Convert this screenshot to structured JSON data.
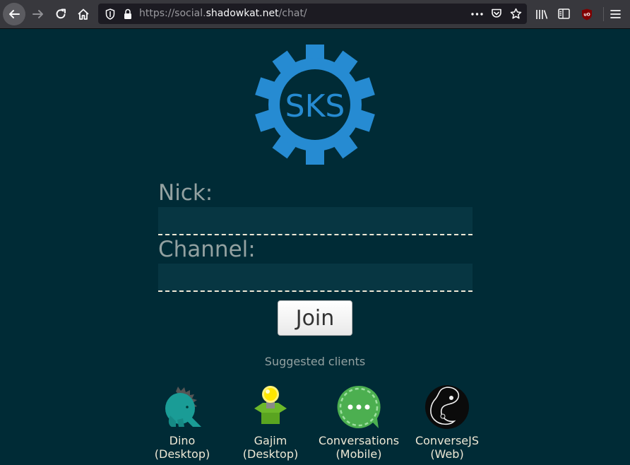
{
  "browser": {
    "url_prefix": "https://social.",
    "url_host": "shadowkat.net",
    "url_path": "/chat/",
    "ublock_badge": "uO"
  },
  "logo": {
    "text": "SKS",
    "color": "#268bd2"
  },
  "form": {
    "nick_label": "Nick:",
    "nick_value": "",
    "channel_label": "Channel:",
    "channel_value": "",
    "join_label": "Join"
  },
  "suggested": {
    "heading": "Suggested clients",
    "clients": [
      {
        "name": "Dino",
        "kind": "(Desktop)",
        "icon": "dino-icon"
      },
      {
        "name": "Gajim",
        "kind": "(Desktop)",
        "icon": "gajim-icon"
      },
      {
        "name": "Conversations",
        "kind": "(Mobile)",
        "icon": "conversations-icon"
      },
      {
        "name": "ConverseJS",
        "kind": "(Web)",
        "icon": "conversejs-icon"
      }
    ]
  },
  "colors": {
    "background": "#002b36",
    "input_background": "#073642",
    "label": "#93a1a1",
    "text": "#eee8d5",
    "accent": "#268bd2"
  }
}
